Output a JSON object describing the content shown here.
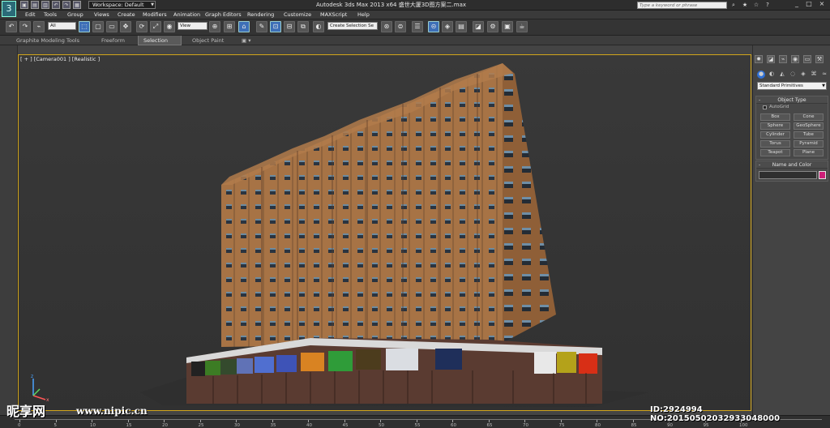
{
  "titlebar": {
    "logo": "3",
    "workspace": "Workspace: Default",
    "window_title": "Autodesk 3ds Max  2013 x64      盛世大厦3D图方案二.max",
    "search_placeholder": "Type a keyword or phrase",
    "quick_access": [
      "▣",
      "▤",
      "▥",
      "↶",
      "↷",
      "▦",
      "▧"
    ],
    "help_icons": [
      "⌕",
      "★",
      "☆",
      "?"
    ],
    "window_buttons": [
      "_",
      "□",
      "×"
    ]
  },
  "menu": {
    "items": [
      "Edit",
      "Tools",
      "Group",
      "Views",
      "Create",
      "Modifiers",
      "Animation",
      "Graph Editors",
      "Rendering",
      "Customize",
      "MAXScript",
      "Help"
    ]
  },
  "toolbar": {
    "selection_filter": "All",
    "reference_coord": "View",
    "named_selection": "Create Selection Se",
    "icons": [
      "↶",
      "↷",
      "⌁",
      "⬚",
      "▢",
      "▭",
      "✥",
      "⟳",
      "⤢",
      "◉",
      "⊕",
      "⊞",
      "⌂",
      "✎",
      "⊡",
      "⊟",
      "⧉",
      "◐",
      "⊛",
      "⊜",
      "☰",
      "⊝",
      "◈",
      "▤",
      "◪",
      "⚙",
      "▣",
      "☕"
    ]
  },
  "ribbon": {
    "tabs": [
      "Graphite Modeling Tools",
      "Freeform",
      "Selection",
      "Object Paint"
    ],
    "active_tab": "Selection"
  },
  "viewport": {
    "label": "[ + ] [Camera001 ] [Realistic ]",
    "background": "#3b3b3b",
    "border_color": "#d1a51b",
    "building_color": "#a77345",
    "base_color": "#5a3b31"
  },
  "command_panel": {
    "tabs": [
      "✹",
      "◪",
      "⌁",
      "◉",
      "▭",
      "⚒"
    ],
    "subtabs": [
      "●",
      "◐",
      "◭",
      "◌",
      "◈",
      "⌘",
      "≈"
    ],
    "primitive_type": "Standard Primitives",
    "object_type": {
      "title": "Object Type",
      "autogrid": "AutoGrid",
      "buttons": [
        "Box",
        "Cone",
        "Sphere",
        "GeoSphere",
        "Cylinder",
        "Tube",
        "Torus",
        "Pyramid",
        "Teapot",
        "Plane"
      ]
    },
    "name_and_color": {
      "title": "Name and Color",
      "swatch_color": "#cc1f78"
    }
  },
  "timeline": {
    "ticks": [
      "0",
      "5",
      "10",
      "15",
      "20",
      "25",
      "30",
      "35",
      "40",
      "45",
      "50",
      "55",
      "60",
      "65",
      "70",
      "75",
      "80",
      "85",
      "90",
      "95",
      "100"
    ]
  },
  "watermark": {
    "brand": "昵享网",
    "url": "www.nipic.cn",
    "id_text": "ID:2924994 NO:20150502032933048000"
  }
}
